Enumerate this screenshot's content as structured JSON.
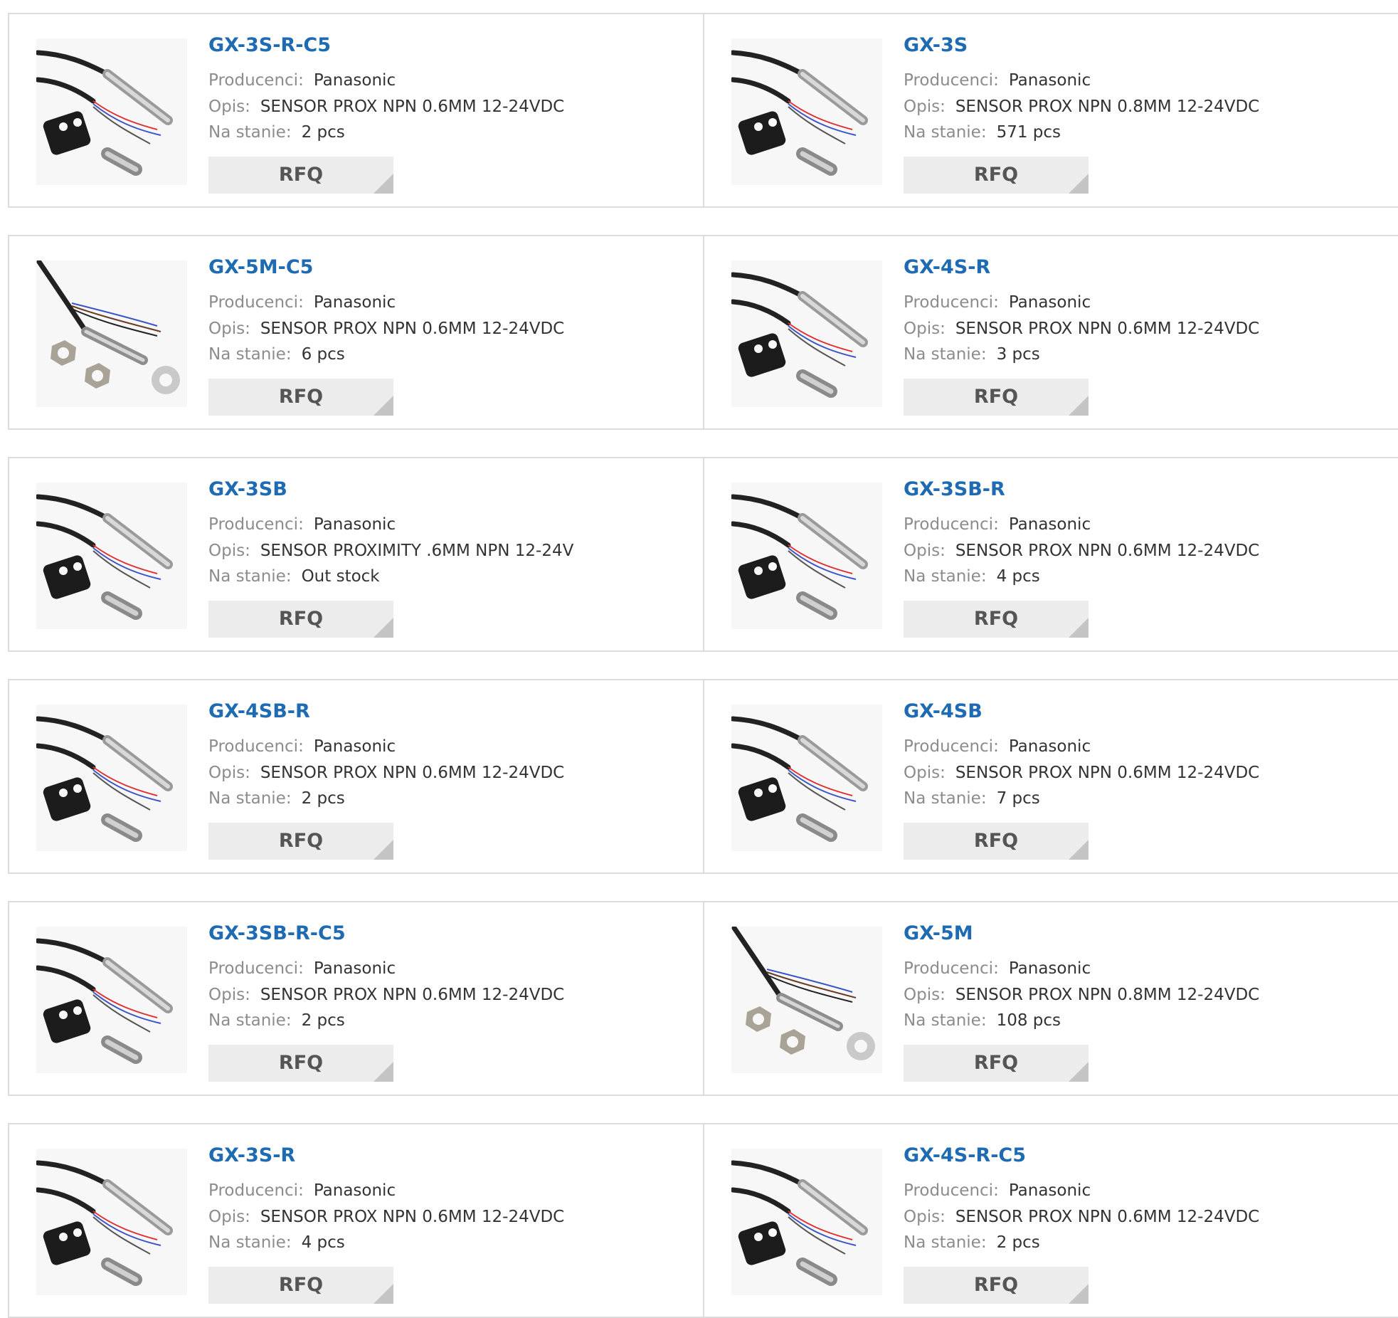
{
  "labels": {
    "manufacturer": "Producenci:",
    "description": "Opis:",
    "stock": "Na stanie:",
    "rfq": "RFQ"
  },
  "products": [
    {
      "part": "GX-3S-R-C5",
      "manufacturer": "Panasonic",
      "description": "SENSOR PROX NPN 0.6MM 12-24VDC",
      "stock": "2 pcs",
      "image": "prox-sensor-bracket"
    },
    {
      "part": "GX-3S",
      "manufacturer": "Panasonic",
      "description": "SENSOR PROX NPN 0.8MM 12-24VDC",
      "stock": "571 pcs",
      "image": "prox-sensor-bracket"
    },
    {
      "part": "GX-5M-C5",
      "manufacturer": "Panasonic",
      "description": "SENSOR PROX NPN 0.6MM 12-24VDC",
      "stock": "6 pcs",
      "image": "prox-sensor-nuts"
    },
    {
      "part": "GX-4S-R",
      "manufacturer": "Panasonic",
      "description": "SENSOR PROX NPN 0.6MM 12-24VDC",
      "stock": "3 pcs",
      "image": "prox-sensor-bracket"
    },
    {
      "part": "GX-3SB",
      "manufacturer": "Panasonic",
      "description": "SENSOR PROXIMITY .6MM NPN 12-24V",
      "stock": "Out stock",
      "image": "prox-sensor-bracket"
    },
    {
      "part": "GX-3SB-R",
      "manufacturer": "Panasonic",
      "description": "SENSOR PROX NPN 0.6MM 12-24VDC",
      "stock": "4 pcs",
      "image": "prox-sensor-bracket"
    },
    {
      "part": "GX-4SB-R",
      "manufacturer": "Panasonic",
      "description": "SENSOR PROX NPN 0.6MM 12-24VDC",
      "stock": "2 pcs",
      "image": "prox-sensor-bracket"
    },
    {
      "part": "GX-4SB",
      "manufacturer": "Panasonic",
      "description": "SENSOR PROX NPN 0.6MM 12-24VDC",
      "stock": "7 pcs",
      "image": "prox-sensor-bracket"
    },
    {
      "part": "GX-3SB-R-C5",
      "manufacturer": "Panasonic",
      "description": "SENSOR PROX NPN 0.6MM 12-24VDC",
      "stock": "2 pcs",
      "image": "prox-sensor-bracket"
    },
    {
      "part": "GX-5M",
      "manufacturer": "Panasonic",
      "description": "SENSOR PROX NPN 0.8MM 12-24VDC",
      "stock": "108 pcs",
      "image": "prox-sensor-nuts"
    },
    {
      "part": "GX-3S-R",
      "manufacturer": "Panasonic",
      "description": "SENSOR PROX NPN 0.6MM 12-24VDC",
      "stock": "4 pcs",
      "image": "prox-sensor-bracket"
    },
    {
      "part": "GX-4S-R-C5",
      "manufacturer": "Panasonic",
      "description": "SENSOR PROX NPN 0.6MM 12-24VDC",
      "stock": "2 pcs",
      "image": "prox-sensor-bracket"
    }
  ]
}
